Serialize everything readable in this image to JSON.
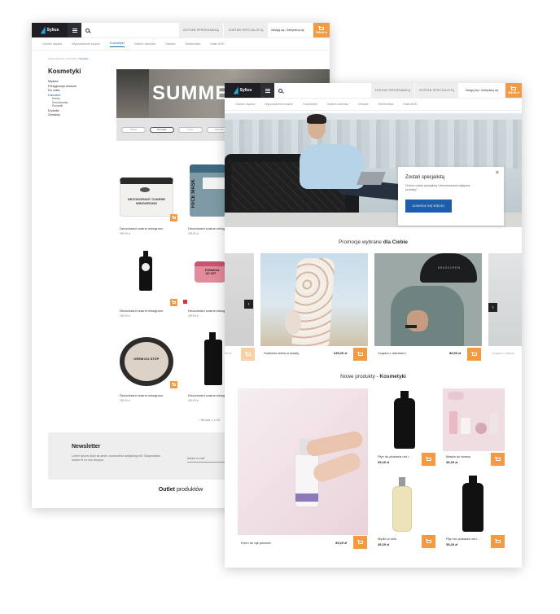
{
  "back_page": {
    "brand": "Sylius",
    "header": {
      "become_seller": "ZOSTAŃ SPRZEDAWCĄ",
      "become_specialist": "ZOSTAŃ SPECJALISTĄ",
      "login": "Zaloguj się / Zarejestruj się",
      "cart_total": "399,99 zł"
    },
    "nav": [
      "Odzież męska",
      "Wyposażenie wnętrz",
      "Kosmetyki",
      "Odzież damska",
      "Obuwie",
      "Elektronika",
      "Małe AGD"
    ],
    "nav_active": "Kosmetyki",
    "breadcrumb": {
      "home": "Strona główna",
      "sep": "/",
      "parent": "Kosmetyki",
      "current": "Damskie"
    },
    "category_title": "Kosmetyki",
    "sidebar": [
      "Męskie",
      "Pielęgnacja włosów",
      "Do ciała",
      "Damskie"
    ],
    "sidebar_sub": [
      "Kremy",
      "Dezodoranty",
      "Pomadki"
    ],
    "sidebar_rest": [
      "Dodatki",
      "Zestawy"
    ],
    "hero_text": "SUMMER",
    "filters": [
      "Marka",
      "Rozmiar",
      "Kolor",
      "Materiał"
    ],
    "products": [
      {
        "name": "Dezodorant czarne winogrono",
        "price": "259,99 zł",
        "jar_label": "DEZODORANT CZARNE WINOGRONO"
      },
      {
        "name": "Dezodorant czarne winogrono",
        "price": "259,99 zł",
        "jar_label": "FACE MASK"
      },
      {
        "name": "Dezodorant czarne winogrono",
        "price": "259,99 zł"
      },
      {
        "name": "Dezodorant czarne winogrono",
        "price": "289,99 zł",
        "jar_label": "POMADKA DO UST"
      },
      {
        "name": "Dezodorant czarne winogrono",
        "price": "259,99 zł",
        "jar_label": "KREM DO STÓP"
      },
      {
        "name": "Dezodorant czarne winogrono",
        "price": "259,99 zł"
      }
    ],
    "pager": "Strona 1 z 20",
    "newsletter": {
      "title": "Newsletter",
      "text": "Lorem ipsum dolor sit amet, consectetur adipiscing elit. Suspendisse ornare et ex non tempus.",
      "email_placeholder": "Adres e-mail"
    },
    "outlet": {
      "word": "Outlet",
      "rest": "produktów"
    }
  },
  "front_page": {
    "brand": "Sylius",
    "header": {
      "become_seller": "ZOSTAŃ SPRZEDAWCĄ",
      "become_specialist": "ZOSTAŃ SPECJALISTĄ",
      "login": "Zaloguj się / Zarejestruj się",
      "cart_total": "399,99 zł"
    },
    "nav": [
      "Odzież męska",
      "Wyposażenie wnętrz",
      "Kosmetyki",
      "Odzież damska",
      "Obuwie",
      "Elektronika",
      "Małe AGD"
    ],
    "promo": {
      "title": "Zostań specjalistą",
      "text": "Chcesz zostać specjalistą i rekomendować najlepsze produkty?",
      "button": "DOWIEDZ SIĘ WIĘCEJ"
    },
    "promotions_title": {
      "lead": "Promocje wybrane",
      "bold": "dla Ciebie"
    },
    "promotions": [
      {
        "name": "",
        "price": "",
        "partial_price": "29 zł"
      },
      {
        "name": "Sukienka letnia w kwiaty",
        "price": "239,29 zł"
      },
      {
        "name": "Czapka z daszkiem",
        "price": "89,99 zł"
      },
      {
        "name": "Czapka z daszk",
        "price": ""
      }
    ],
    "cap_text": "BRASSCREW",
    "new_title": {
      "lead": "Nowe produkty",
      "dash": " - ",
      "bold": "Kosmetyki"
    },
    "new_products": [
      {
        "name": "Krem do rąk piwonia",
        "price": "39,29 zł"
      },
      {
        "name": "Płyn do płukania ust i...",
        "price": "39,29 zł"
      },
      {
        "name": "Maska do twarzy",
        "price": "39,29 zł"
      },
      {
        "name": "Mydło w żelu",
        "price": "39,29 zł"
      },
      {
        "name": "Płyn do płukania ust i...",
        "price": "39,29 zł"
      }
    ]
  },
  "colors": {
    "accent_orange": "#f39a45",
    "brand_blue": "#1c5fa8",
    "dark": "#1d1f24"
  }
}
